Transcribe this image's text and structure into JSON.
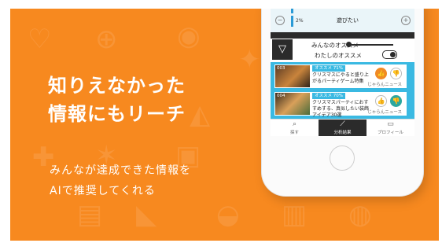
{
  "headline": {
    "line1": "知りえなかった",
    "line2": "情報にもリーチ"
  },
  "subtext": {
    "line1": "みんなが達成できた情報を",
    "line2": "AIで推奨してくれる"
  },
  "app": {
    "progress_row": {
      "percent_label": "2%",
      "item_label": "遊びたい",
      "minus": "−",
      "plus": "+"
    },
    "filter": {
      "everyone_label": "みんなのオススメ",
      "mine_label": "わたしのオススメ",
      "funnel_icon": "▽"
    },
    "cards": [
      {
        "rank": "003",
        "badge": "オススメ 71%",
        "title": "クリスマスにやると盛り上がるパーティゲーム特集",
        "source": "じゃらんニュース"
      },
      {
        "rank": "004",
        "badge": "オススメ 70%",
        "title": "クリスマスパーティにおすすめする、真似したい装飾アイデア30選",
        "source": "じゃらんニュース"
      }
    ],
    "tabs": [
      {
        "label": "探す",
        "icon": "⌕"
      },
      {
        "label": "分析結果",
        "icon": "⟋"
      },
      {
        "label": "プロフィール",
        "icon": "▭"
      }
    ]
  },
  "colors": {
    "banner": "#f7891f",
    "accent_blue": "#3ab9e2",
    "like_orange": "#f08a24",
    "dislike_teal": "#2aa7a0"
  }
}
